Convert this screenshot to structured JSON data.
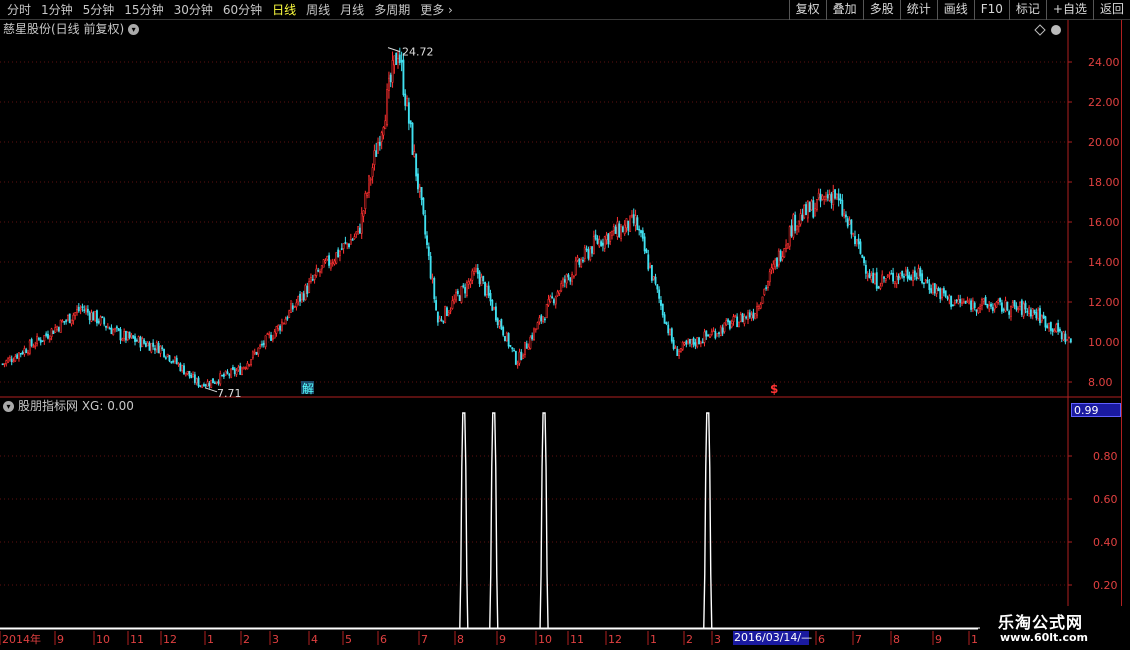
{
  "toolbar": {
    "periods": [
      "分时",
      "1分钟",
      "5分钟",
      "15分钟",
      "30分钟",
      "60分钟",
      "日线",
      "周线",
      "月线",
      "多周期",
      "更多"
    ],
    "active_period": "日线",
    "buttons": [
      "复权",
      "叠加",
      "多股",
      "统计",
      "画线",
      "F10",
      "标记",
      "+自选",
      "返回"
    ]
  },
  "main_panel": {
    "title": "慈星股份(日线 前复权)",
    "high_label": "24.72",
    "low_label": "7.71",
    "markers": [
      "解",
      "$"
    ]
  },
  "sub_panel": {
    "title": "股朋指标网  XG: 0.00",
    "value_box": "0.99"
  },
  "cursor_date": "2016/03/14/—",
  "watermark": {
    "line1": "乐淘公式网",
    "line2": "www.60lt.com"
  },
  "colors": {
    "up": "#ff3030",
    "down": "#40e0f0",
    "axis": "#b02020",
    "signal": "#ffffff",
    "grid": "#601010"
  },
  "chart_data": [
    {
      "type": "candlestick",
      "title": "慈星股份(日线 前复权)",
      "y_ticks": [
        8.0,
        10.0,
        12.0,
        14.0,
        16.0,
        18.0,
        20.0,
        22.0,
        24.0
      ],
      "ylim": [
        7.5,
        25.0
      ],
      "x_tick_labels": [
        "2014年",
        "9",
        "10",
        "11",
        "12",
        "1",
        "2",
        "3",
        "4",
        "5",
        "6",
        "7",
        "8",
        "9",
        "10",
        "11",
        "12",
        "1",
        "2",
        "3",
        "2016/03/14/—",
        "6",
        "7",
        "8",
        "9",
        "1"
      ],
      "approx_close_path": [
        {
          "t": "2014-08",
          "v": 8.9
        },
        {
          "t": "2014-09",
          "v": 10.2
        },
        {
          "t": "2014-10",
          "v": 11.7
        },
        {
          "t": "2014-11",
          "v": 10.3
        },
        {
          "t": "2014-12",
          "v": 9.7
        },
        {
          "t": "2015-01",
          "v": 7.8
        },
        {
          "t": "2015-02",
          "v": 8.6
        },
        {
          "t": "2015-03",
          "v": 10.8
        },
        {
          "t": "2015-04",
          "v": 13.5
        },
        {
          "t": "2015-05",
          "v": 15.5
        },
        {
          "t": "2015-06",
          "v": 24.72
        },
        {
          "t": "2015-07",
          "v": 11.0
        },
        {
          "t": "2015-08",
          "v": 13.5
        },
        {
          "t": "2015-09",
          "v": 9.0
        },
        {
          "t": "2015-10",
          "v": 12.5
        },
        {
          "t": "2015-11",
          "v": 15.0
        },
        {
          "t": "2015-12",
          "v": 16.0
        },
        {
          "t": "2016-01",
          "v": 9.5
        },
        {
          "t": "2016-02",
          "v": 10.5
        },
        {
          "t": "2016-03",
          "v": 11.5
        },
        {
          "t": "2016-04",
          "v": 16.0
        },
        {
          "t": "2016-05",
          "v": 17.5
        },
        {
          "t": "2016-06",
          "v": 13.0
        },
        {
          "t": "2016-07",
          "v": 13.5
        },
        {
          "t": "2016-08",
          "v": 12.0
        },
        {
          "t": "2016-09",
          "v": 11.8
        },
        {
          "t": "2016-10",
          "v": 11.6
        },
        {
          "t": "2016-11",
          "v": 10.0
        }
      ],
      "annotations": [
        {
          "text": "24.72"
        },
        {
          "text": "7.71"
        }
      ]
    },
    {
      "type": "line",
      "title": "股朋指标网 XG",
      "y_ticks": [
        0.2,
        0.4,
        0.6,
        0.8
      ],
      "ylim": [
        0,
        1
      ],
      "series": [
        {
          "name": "XG",
          "signal_fraction_positions": [
            0.44,
            0.468,
            0.515,
            0.668
          ],
          "signal_value": 1.0,
          "baseline": 0.0
        }
      ]
    }
  ]
}
